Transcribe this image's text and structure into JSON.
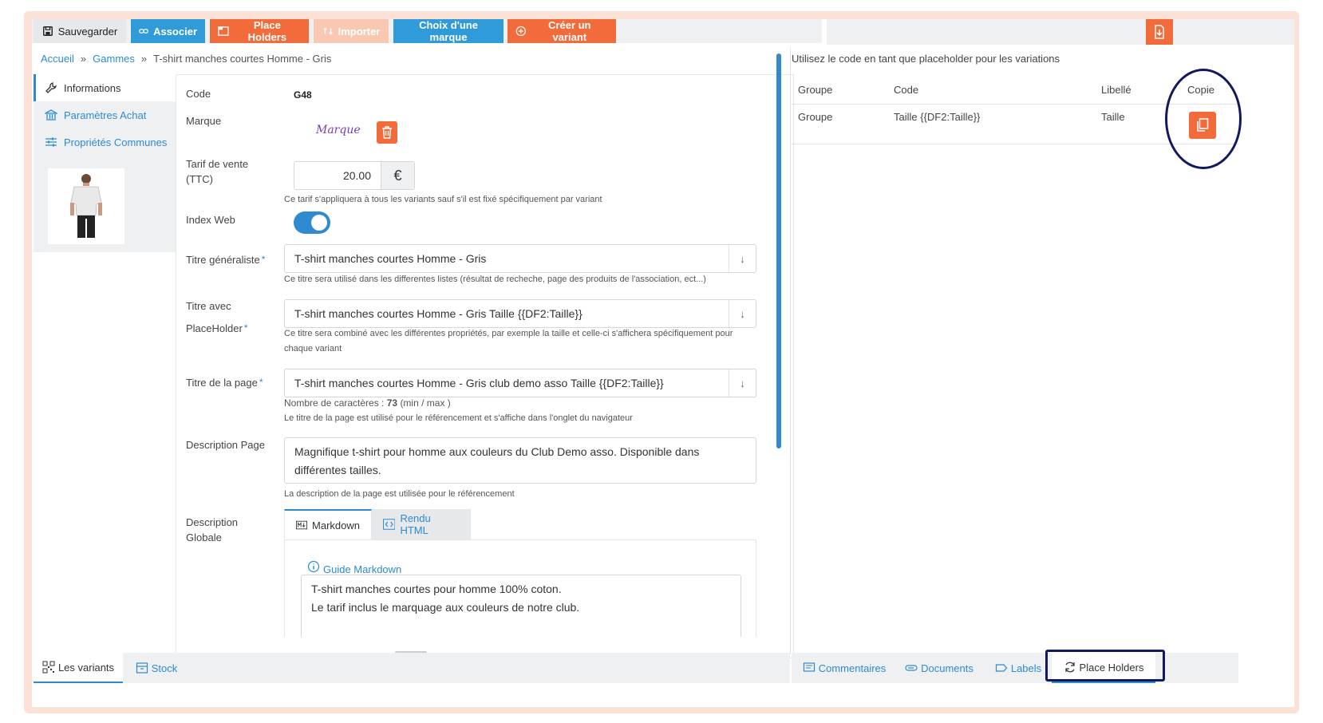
{
  "colors": {
    "accent_blue": "#2f8ad0",
    "orange": "#f26b3a",
    "annotation": "#12195e"
  },
  "toolbar": {
    "save": "Sauvegarder",
    "associate": "Associer",
    "placeholders": "Place Holders",
    "import": "Importer",
    "choose_brand": "Choix d'une marque",
    "create_variant": "Créer un variant"
  },
  "breadcrumb": {
    "home": "Accueil",
    "sep1": "»",
    "ranges": "Gammes",
    "sep2": "»",
    "current": "T-shirt manches courtes Homme - Gris"
  },
  "sidebar": {
    "items": [
      {
        "label": "Informations",
        "icon": "wrench-icon"
      },
      {
        "label": "Paramètres Achat",
        "icon": "bank-icon"
      },
      {
        "label": "Propriétés Communes",
        "icon": "sliders-icon"
      }
    ]
  },
  "form": {
    "code_label": "Code",
    "code_value": "G48",
    "brand_label": "Marque",
    "brand_logo_text": "Marque",
    "price_label": "Tarif de vente (TTC)",
    "price_value": "20.00",
    "currency": "€",
    "price_help": "Ce tarif s'appliquera à tous les variants sauf s'il est fixé spécifiquement par variant",
    "index_label": "Index Web",
    "title_general_label": "Titre généraliste",
    "title_general_value": "T-shirt manches courtes Homme - Gris",
    "title_general_help": "Ce titre sera utilisé dans les differentes listes (résultat de recheche, page des produits de l'association, ect...)",
    "title_ph_label_1": "Titre avec",
    "title_ph_label_2": "PlaceHolder",
    "title_ph_value": "T-shirt manches courtes Homme - Gris Taille {{DF2:Taille}}",
    "title_ph_help": "Ce titre sera combiné avec les différentes propriétés, par exemple la taille et celle-ci s'affichera spécifiquement pour chaque variant",
    "page_title_label": "Titre de la page",
    "page_title_value": "T-shirt manches courtes Homme - Gris club demo asso Taille {{DF2:Taille}}",
    "char_count_prefix": "Nombre de caractères :",
    "char_count": "73",
    "char_count_suffix": "(min / max )",
    "page_title_help": "Le titre de la page est utilisé pour le référencement et s'affiche dans l'onglet du navigateur",
    "desc_page_label": "Description Page",
    "desc_page_value": "Magnifique t-shirt pour homme aux couleurs du Club Demo asso. Disponible dans différentes tailles.",
    "desc_page_help": "La description de la page est utilisée pour le référencement",
    "desc_global_label_1": "Description",
    "desc_global_label_2": "Globale",
    "tab_markdown": "Markdown",
    "tab_html": "Rendu HTML",
    "guide": "Guide Markdown",
    "markdown_value": "T-shirt manches courtes pour homme 100% coton.\nLe tarif inclus le marquage aux couleurs de notre club.",
    "required": "*"
  },
  "right_panel": {
    "hint": "Utilisez le code en tant que placeholder pour les variations",
    "headers": [
      "Groupe",
      "Code",
      "Libellé",
      "Copie"
    ],
    "rows": [
      {
        "groupe": "Groupe",
        "code": "Taille {{DF2:Taille}}",
        "libelle": "Taille"
      }
    ]
  },
  "bottom_tabs_left": [
    "Les variants",
    "Stock"
  ],
  "bottom_tabs_right": [
    "Commentaires",
    "Documents",
    "Labels",
    "Place Holders"
  ]
}
